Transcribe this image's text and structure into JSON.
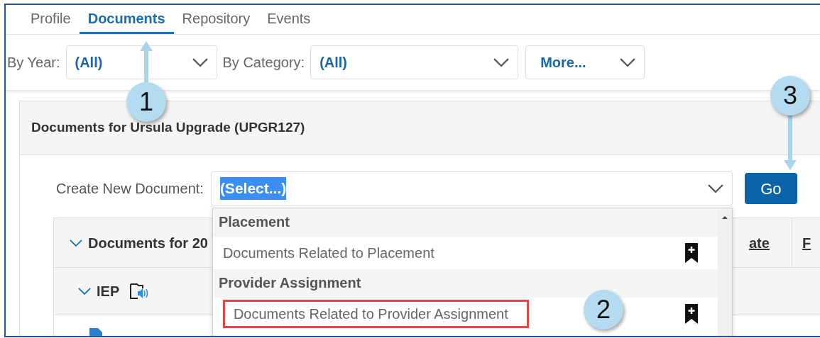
{
  "tabs": [
    {
      "label": "Profile",
      "selected": false
    },
    {
      "label": "Documents",
      "selected": true
    },
    {
      "label": "Repository",
      "selected": false
    },
    {
      "label": "Events",
      "selected": false
    }
  ],
  "filters": [
    {
      "label": "By Year:",
      "value": "(All)"
    },
    {
      "label": "By Category:",
      "value": "(All)"
    },
    {
      "value": "More..."
    }
  ],
  "panel": {
    "title": "Documents for Ursula Upgrade (UPGR127)",
    "create_label": "Create New Document:",
    "create_value": "(Select...)",
    "go_button": "Go"
  },
  "table": {
    "group": {
      "label": "Documents for 20",
      "expanded": true
    },
    "columns": [
      "ate",
      "F"
    ],
    "subgroup": {
      "label": "IEP",
      "expanded": true
    }
  },
  "dropdown": {
    "groups": [
      {
        "label": "Placement",
        "items": [
          {
            "label": "Documents Related to Placement",
            "highlighted": false
          }
        ]
      },
      {
        "label": "Provider Assignment",
        "items": [
          {
            "label": "Documents Related to Provider Assignment",
            "highlighted": true
          }
        ]
      }
    ]
  },
  "callouts": [
    {
      "label": "1"
    },
    {
      "label": "2"
    },
    {
      "label": "3"
    }
  ]
}
